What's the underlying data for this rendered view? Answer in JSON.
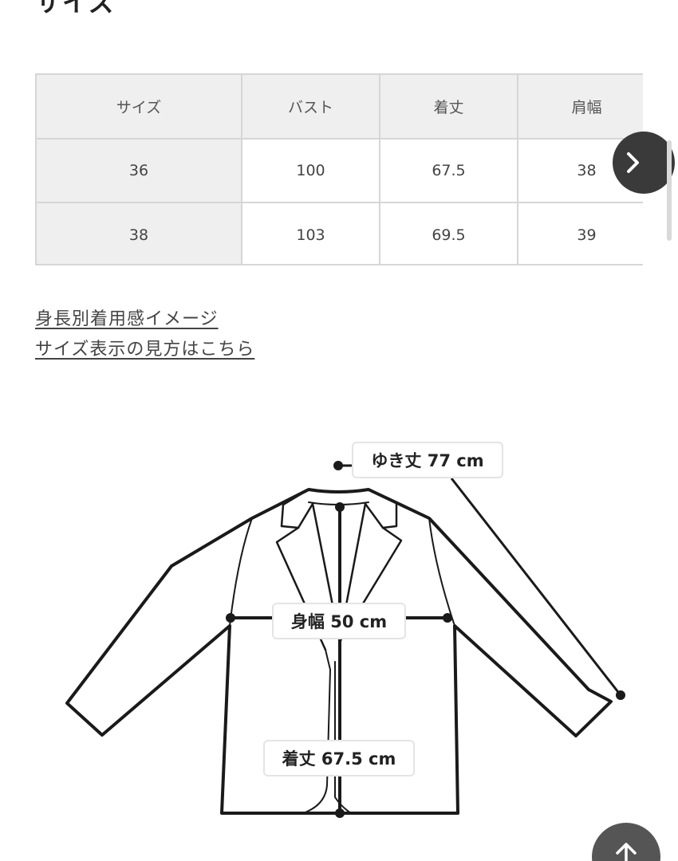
{
  "header": {
    "title": "サイズ",
    "close_icon": "close-icon",
    "accent": "#7b3fd1"
  },
  "size_table": {
    "columns": [
      "サイズ",
      "バスト",
      "着丈",
      "肩幅"
    ],
    "rows": [
      [
        "36",
        "100",
        "67.5",
        "38"
      ],
      [
        "38",
        "103",
        "69.5",
        "39"
      ]
    ]
  },
  "links": {
    "fit_by_height": "身長別着用感イメージ",
    "how_to_read": "サイズ表示の見方はこちら"
  },
  "diagram": {
    "sleeve_label": "ゆき丈 77 cm",
    "width_label": "身幅 50 cm",
    "length_label": "着丈 67.5 cm"
  },
  "controls": {
    "next_icon": "chevron-right-icon",
    "top_icon": "arrow-up-icon"
  }
}
